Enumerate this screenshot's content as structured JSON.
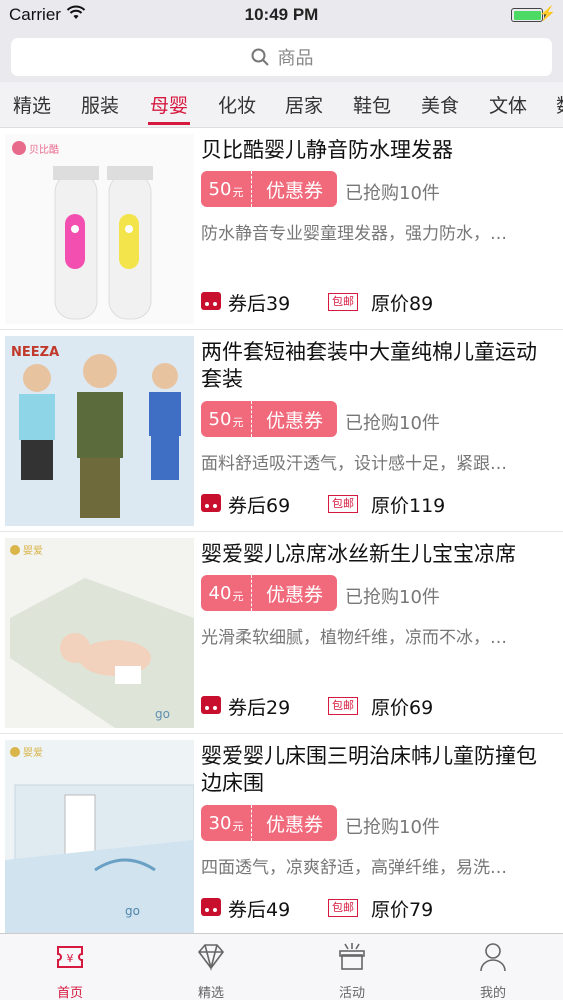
{
  "status_bar": {
    "carrier": "Carrier",
    "time": "10:49 PM"
  },
  "search": {
    "placeholder": "商品"
  },
  "categories": {
    "items": [
      "精选",
      "服装",
      "母婴",
      "化妆",
      "居家",
      "鞋包",
      "美食",
      "文体",
      "数"
    ],
    "active": "母婴"
  },
  "products": [
    {
      "brand_logo": "贝比酷",
      "title": "贝比酷婴儿静音防水理发器",
      "coupon_amount": "50",
      "coupon_unit": "元",
      "coupon_label": "优惠券",
      "sold": "已抢购10件",
      "desc": "防水静音专业婴童理发器，强力防水，…",
      "after_price": "券后39",
      "shipping": "包邮",
      "original_price": "原价89"
    },
    {
      "brand_logo": "NEEZA",
      "title": "两件套短袖套装中大童纯棉儿童运动套装",
      "coupon_amount": "50",
      "coupon_unit": "元",
      "coupon_label": "优惠券",
      "sold": "已抢购10件",
      "desc": "面料舒适吸汗透气，设计感十足，紧跟…",
      "after_price": "券后69",
      "shipping": "包邮",
      "original_price": "原价119"
    },
    {
      "brand_logo": "婴爱",
      "title": "婴爱婴儿凉席冰丝新生儿宝宝凉席",
      "coupon_amount": "40",
      "coupon_unit": "元",
      "coupon_label": "优惠券",
      "sold": "已抢购10件",
      "desc": "光滑柔软细腻，植物纤维，凉而不冰，…",
      "after_price": "券后29",
      "shipping": "包邮",
      "original_price": "原价69"
    },
    {
      "brand_logo": "婴爱",
      "title": "婴爱婴儿床围三明治床帏儿童防撞包边床围",
      "coupon_amount": "30",
      "coupon_unit": "元",
      "coupon_label": "优惠券",
      "sold": "已抢购10件",
      "desc": "四面透气，凉爽舒适，高弹纤维，易洗…",
      "after_price": "券后49",
      "shipping": "包邮",
      "original_price": "原价79"
    }
  ],
  "tabbar": {
    "items": [
      "首页",
      "精选",
      "活动",
      "我的"
    ],
    "active": "首页"
  },
  "colors": {
    "accent": "#d6193f",
    "coupon": "#f06a7c",
    "battery": "#4cd964"
  },
  "icons": [
    "wifi-icon",
    "battery-icon",
    "search-icon",
    "ticket-icon",
    "diamond-icon",
    "gift-icon",
    "person-icon",
    "coupon-after-icon"
  ]
}
